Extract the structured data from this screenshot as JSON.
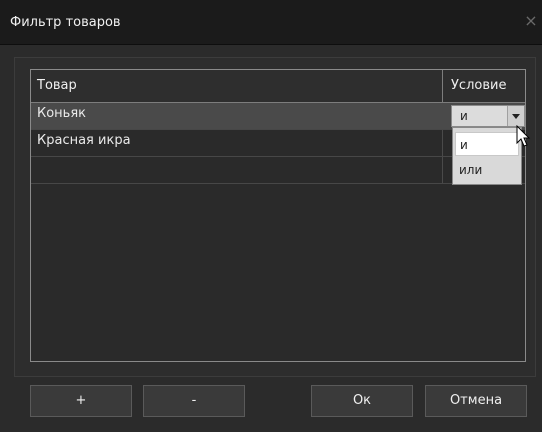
{
  "window": {
    "title": "Фильтр товаров",
    "close_symbol": "×"
  },
  "grid": {
    "columns": [
      "Товар",
      "Условие"
    ],
    "rows": [
      {
        "product": "Коньяк",
        "condition": "и",
        "selected": true
      },
      {
        "product": "Красная икра",
        "condition": ""
      },
      {
        "product": "",
        "condition": ""
      }
    ]
  },
  "dropdown": {
    "options": [
      "и",
      "или"
    ],
    "highlighted": "и"
  },
  "buttons": {
    "add": "+",
    "remove": "-",
    "ok": "Ок",
    "cancel": "Отмена"
  },
  "colors": {
    "background": "#2b2b2b",
    "titlebar": "#1b1b1b",
    "selected_row": "#4a4a4a"
  }
}
